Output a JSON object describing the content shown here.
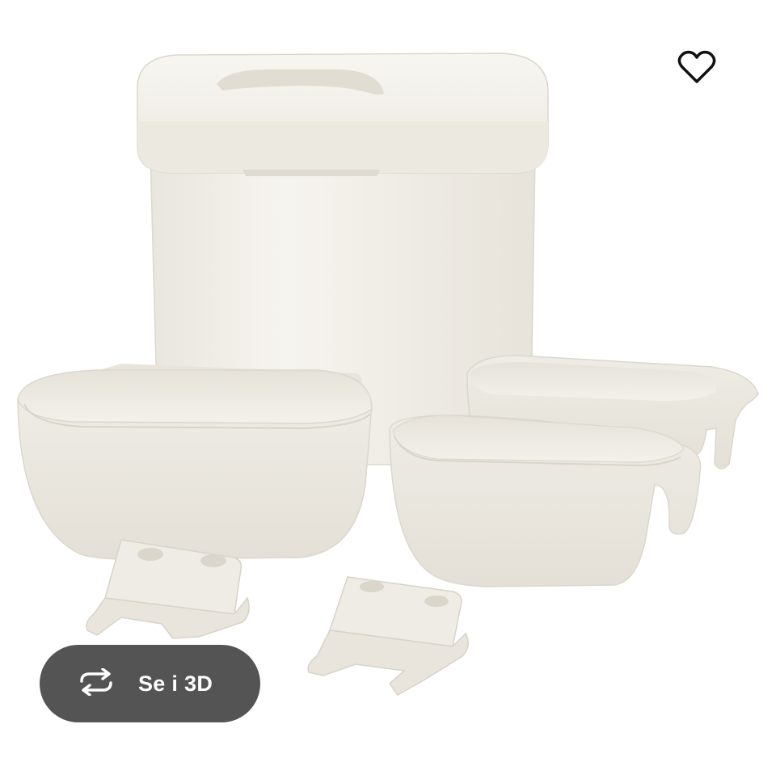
{
  "product_image": {
    "alt": "",
    "items": [
      "bin-with-lid",
      "large-tray",
      "small-tray-back",
      "small-tray-front",
      "wall-bracket-left",
      "wall-bracket-right"
    ]
  },
  "favorite": {
    "icon": "heart-outline-icon"
  },
  "view_3d": {
    "icon": "rotate-arrows-icon",
    "label": "Se i 3D"
  },
  "colors": {
    "product": "#f1efe9",
    "shadow": "#d9d5cc",
    "pill_bg": "#545454",
    "pill_text": "#ffffff"
  }
}
